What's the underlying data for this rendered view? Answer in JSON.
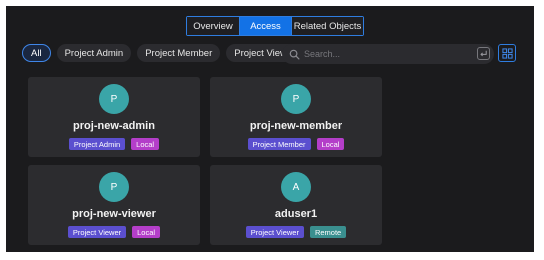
{
  "tabs": [
    {
      "label": "Overview",
      "active": false
    },
    {
      "label": "Access",
      "active": true
    },
    {
      "label": "Related Objects",
      "active": false
    }
  ],
  "filters": [
    {
      "label": "All",
      "selected": true
    },
    {
      "label": "Project Admin",
      "selected": false
    },
    {
      "label": "Project Member",
      "selected": false
    },
    {
      "label": "Project Viewer",
      "selected": false
    }
  ],
  "search": {
    "placeholder": "Search...",
    "value": ""
  },
  "cards": [
    {
      "initial": "P",
      "name": "proj-new-admin",
      "role": "Project Admin",
      "source": "Local"
    },
    {
      "initial": "P",
      "name": "proj-new-member",
      "role": "Project Member",
      "source": "Local"
    },
    {
      "initial": "P",
      "name": "proj-new-viewer",
      "role": "Project Viewer",
      "source": "Local"
    },
    {
      "initial": "A",
      "name": "aduser1",
      "role": "Project Viewer",
      "source": "Remote"
    }
  ],
  "colors": {
    "accent": "#1372e6",
    "avatar": "#3aa5a8",
    "role_badge": "#5b4fcf",
    "local_badge": "#b43ec9",
    "remote_badge": "#3a8f8f"
  },
  "icons": {
    "search": "search-icon",
    "enter": "enter-key-icon",
    "grid_view": "grid-view-icon"
  }
}
